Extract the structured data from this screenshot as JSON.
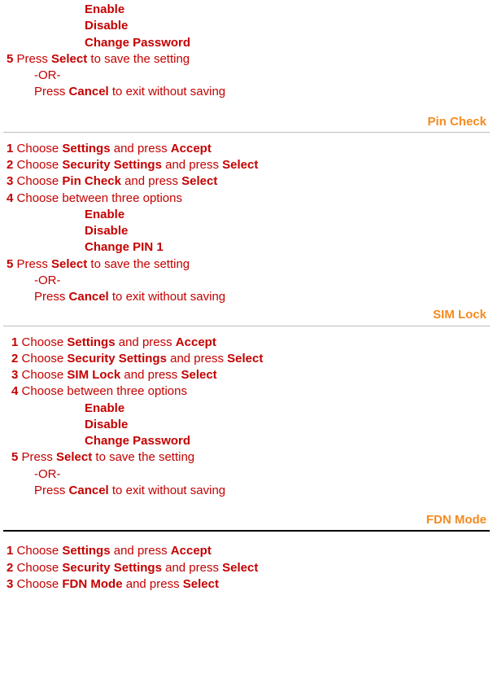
{
  "common": {
    "enable": "Enable",
    "disable": "Disable",
    "changePassword": "Change Password",
    "changePin1": "Change PIN 1",
    "settings": "Settings",
    "accept": "Accept",
    "securitySettings": "Security Settings",
    "select": "Select",
    "cancel": "Cancel",
    "or": "-OR-",
    "chooseBetween": "Choose between three options",
    "saveSetting": "to save the setting",
    "exitNoSave": "to exit without saving",
    "press": "Press",
    "choose": "Choose",
    "andPress": "and press"
  },
  "sections": {
    "pinCheck": {
      "title": "Pin Check",
      "menuItem": "Pin Check"
    },
    "simLock": {
      "title": "SIM Lock",
      "menuItem": "SIM Lock"
    },
    "fdnMode": {
      "title": "FDN Mode",
      "menuItem": "FDN Mode"
    }
  },
  "steps": {
    "n1": "1",
    "n2": "2",
    "n3": "3",
    "n4": "4",
    "n5": "5"
  }
}
